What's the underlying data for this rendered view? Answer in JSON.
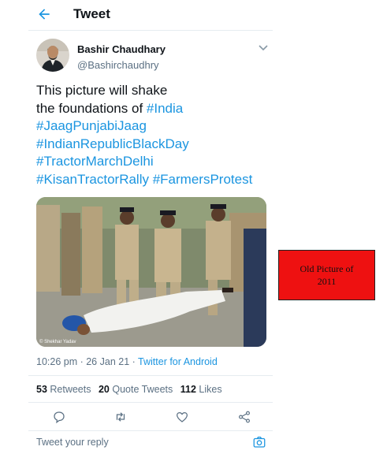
{
  "header": {
    "title": "Tweet"
  },
  "author": {
    "name": "Bashir Chaudhary",
    "handle": "@Bashirchaudhry"
  },
  "tweet": {
    "text_line1": "This picture will shake",
    "text_line2_prefix": "the foundations of ",
    "hashtags": [
      "#India",
      "#JaagPunjabiJaag",
      "#IndianRepublicBlackDay",
      "#TractorMarchDelhi",
      "#KisanTractorRally",
      "#FarmersProtest"
    ],
    "photo_credit": "© Shekhar Yadav"
  },
  "meta": {
    "time": "10:26 pm",
    "separator": " · ",
    "date": "26 Jan 21",
    "separator2": " · ",
    "source": "Twitter for Android"
  },
  "stats": {
    "retweets_count": "53",
    "retweets_label": " Retweets",
    "quotes_count": "20",
    "quotes_label": " Quote Tweets",
    "likes_count": "112",
    "likes_label": " Likes"
  },
  "overlay": {
    "line1": "Old Picture of",
    "line2": "2011"
  },
  "reply": {
    "placeholder": "Tweet your reply"
  },
  "colors": {
    "link": "#1b95e0",
    "overlay_bg": "#ee1111",
    "muted": "#5b7083"
  },
  "icons": [
    "back-arrow-icon",
    "chevron-down-icon",
    "reply-icon",
    "retweet-icon",
    "like-icon",
    "share-icon",
    "camera-icon"
  ]
}
